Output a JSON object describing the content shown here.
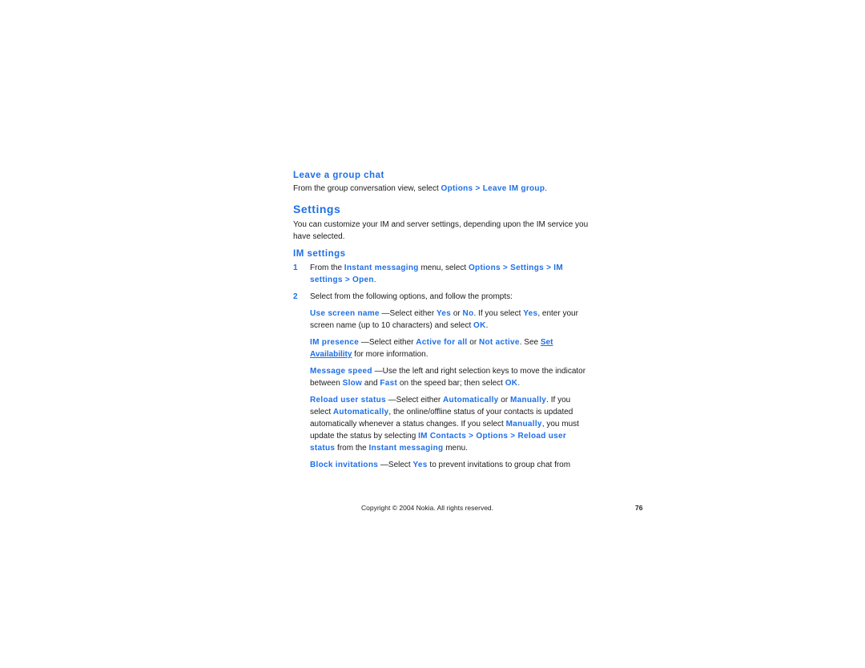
{
  "leave_group_chat": {
    "heading": "Leave a group chat",
    "text": "From the group conversation view, select ",
    "path": "Options > Leave IM group",
    "end": "."
  },
  "settings": {
    "heading": "Settings",
    "intro": "You can customize your IM and server settings, depending upon the IM service you have selected."
  },
  "im_settings": {
    "heading": "IM settings",
    "steps": [
      {
        "number": "1",
        "t1": "From the ",
        "b1": "Instant messaging",
        "t2": " menu, select ",
        "b2": "Options > Settings > IM settings > Open",
        "t3": "."
      },
      {
        "number": "2",
        "t1": "Select from the following options, and follow the prompts:"
      }
    ],
    "options": {
      "screen_name": {
        "term": "Use screen name",
        "t1": " —Select either ",
        "b1": "Yes",
        "t2": " or ",
        "b2": "No",
        "t3": ". If you select ",
        "b3": "Yes",
        "t4": ", enter your screen name (up to 10 characters) and select ",
        "b4": "OK",
        "t5": "."
      },
      "presence": {
        "term": "IM presence",
        "t1": " —Select either ",
        "b1": "Active for all",
        "t2": " or ",
        "b2": "Not active",
        "t3": ". See ",
        "link": "Set Availability",
        "t4": " for more information."
      },
      "speed": {
        "term": "Message speed",
        "t1": " —Use the left and right selection keys to move the indicator between ",
        "b1": "Slow",
        "t2": " and ",
        "b2": "Fast",
        "t3": " on the speed bar; then select ",
        "b3": "OK",
        "t4": "."
      },
      "reload": {
        "term": "Reload user status",
        "t1": " —Select either ",
        "b1": "Automatically",
        "t2": " or ",
        "b2": "Manually",
        "t3": ". If you select ",
        "b3": "Automatically",
        "t4": ", the online/offline status of your contacts is updated automatically whenever a status changes. If you select ",
        "b4": "Manually",
        "t5": ", you must update the status by selecting ",
        "b5": "IM Contacts > Options > Reload user status",
        "t6": " from the ",
        "b6": "Instant messaging",
        "t7": " menu."
      },
      "block": {
        "term": "Block invitations",
        "t1": " —Select ",
        "b1": "Yes",
        "t2": " to prevent invitations to group chat from"
      }
    }
  },
  "footer": {
    "copyright": "Copyright © 2004 Nokia. All rights reserved.",
    "page_number": "76"
  },
  "colors": {
    "accent": "#1f6fe5",
    "text": "#1a1a1a"
  }
}
